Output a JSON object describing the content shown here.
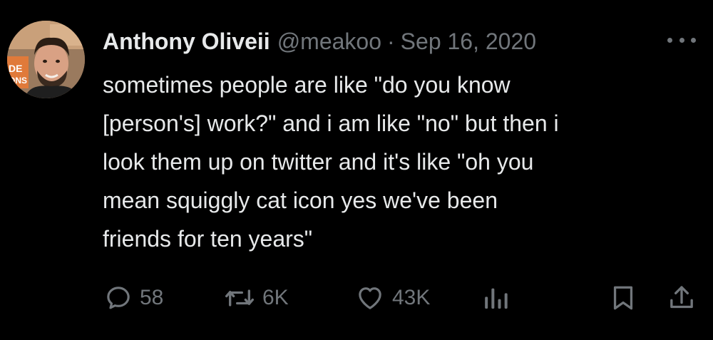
{
  "tweet": {
    "author": {
      "display_name": "Anthony Oliveii",
      "handle": "@meakoo",
      "avatar_icon": "profile-photo",
      "avatar_sign_text": "DE ONS"
    },
    "separator": "·",
    "date": "Sep 16, 2020",
    "more_icon": "more-horizontal-icon",
    "lines": [
      "sometimes people are like \"do you know",
      "[person's] work?\" and i am like \"no\" but then i",
      "look them up on twitter and it's like \"oh you",
      "mean squiggly cat icon yes we've been",
      "friends for ten years\""
    ],
    "actions": {
      "replies": "58",
      "retweets": "6K",
      "likes": "43K"
    }
  },
  "colors": {
    "background": "#000000",
    "primary_text": "#e7e9ea",
    "secondary_text": "#71767b"
  }
}
